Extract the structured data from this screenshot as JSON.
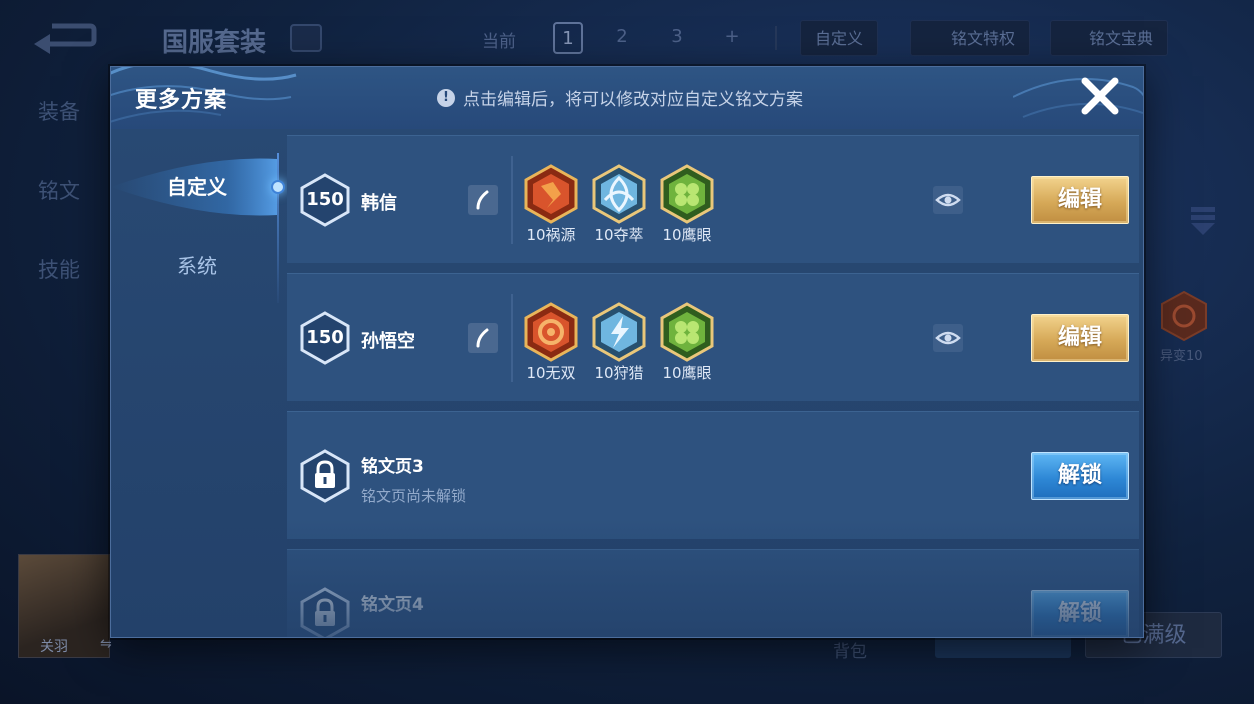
{
  "background": {
    "set_title": "国服套装",
    "current_label": "当前",
    "pages": [
      "1",
      "2",
      "3",
      "+"
    ],
    "tab_custom": "自定义",
    "privilege_label": "铭文特权",
    "dictionary_label": "铭文宝典",
    "side_nav": [
      "装备",
      "铭文",
      "技能"
    ],
    "hero_name": "关羽",
    "hero_swap_glyph": "⇋",
    "bag_label": "背包",
    "rune_side_label": "异变10",
    "buttons": [
      "已满级"
    ]
  },
  "modal": {
    "title": "更多方案",
    "notice_icon": "!",
    "notice": "点击编辑后，将可以修改对应自定义铭文方案",
    "tabs": [
      {
        "label": "自定义",
        "active": true
      },
      {
        "label": "系统",
        "active": false
      }
    ],
    "rows": [
      {
        "level": "150",
        "hero": "韩信",
        "runes": [
          {
            "label": "10祸源",
            "color": "red",
            "icon": "rune-red-shard"
          },
          {
            "label": "10夺萃",
            "color": "blue",
            "icon": "rune-blue-knot"
          },
          {
            "label": "10鹰眼",
            "color": "green",
            "icon": "rune-green-clover"
          }
        ],
        "action": "编辑"
      },
      {
        "level": "150",
        "hero": "孙悟空",
        "runes": [
          {
            "label": "10无双",
            "color": "red",
            "icon": "rune-red-spiral"
          },
          {
            "label": "10狩猎",
            "color": "blue",
            "icon": "rune-blue-lightning"
          },
          {
            "label": "10鹰眼",
            "color": "green",
            "icon": "rune-green-clover"
          }
        ],
        "action": "编辑"
      },
      {
        "page_name": "铭文页3",
        "status": "铭文页尚未解锁",
        "action": "解锁"
      },
      {
        "page_name": "铭文页4",
        "action": "解锁"
      }
    ]
  },
  "colors": {
    "edit_button": "#d6a958",
    "unlock_button": "#2e88d6",
    "rune_red": "#d9542c",
    "rune_blue": "#6fb6e0",
    "rune_green": "#6fb33d"
  }
}
